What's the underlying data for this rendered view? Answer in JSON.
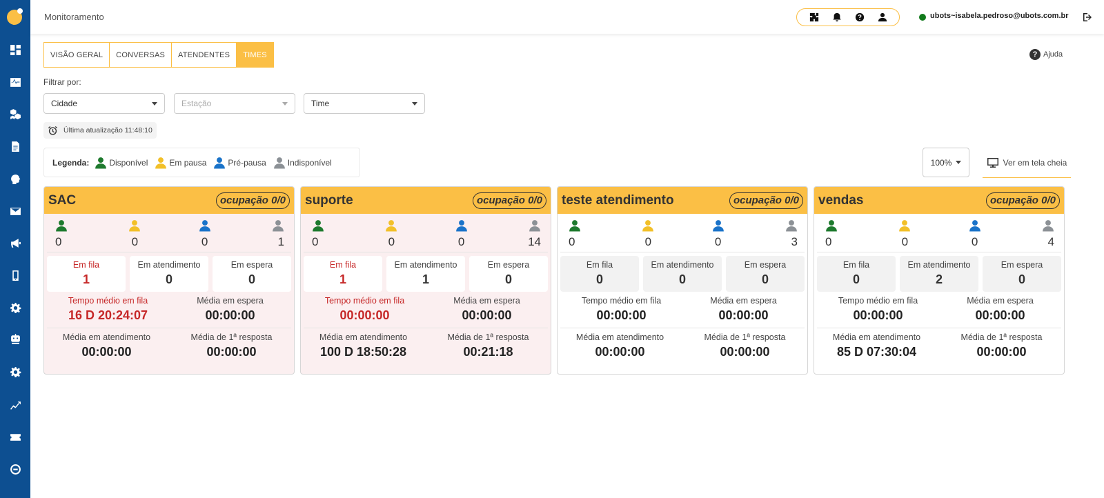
{
  "header": {
    "title": "Monitoramento",
    "user_email": "ubots~isabela.pedroso@ubots.com.br",
    "status_color": "#117a1b"
  },
  "tabs": [
    {
      "label": "VISÃO GERAL",
      "active": false
    },
    {
      "label": "CONVERSAS",
      "active": false
    },
    {
      "label": "ATENDENTES",
      "active": false
    },
    {
      "label": "TIMES",
      "active": true
    }
  ],
  "help_label": "Ajuda",
  "filters": {
    "label": "Filtrar por:",
    "city": "Cidade",
    "station": "Estação",
    "team": "Time"
  },
  "last_update": "Última atualização 11:48:10",
  "legend": {
    "title": "Legenda:",
    "items": [
      {
        "label": "Disponível",
        "color": "#1e7a2e"
      },
      {
        "label": "Em pausa",
        "color": "#f2c029"
      },
      {
        "label": "Pré-pausa",
        "color": "#1a73c9"
      },
      {
        "label": "Indisponível",
        "color": "#8c9196"
      }
    ]
  },
  "zoom": "100%",
  "fullscreen_label": "Ver em tela cheia",
  "teams": [
    {
      "name": "SAC",
      "occupancy": "ocupação 0/0",
      "agents": [
        "0",
        "0",
        "0",
        "1"
      ],
      "queue": {
        "label": "Em fila",
        "value": "1"
      },
      "in_service": {
        "label": "Em atendimento",
        "value": "0"
      },
      "waiting": {
        "label": "Em espera",
        "value": "0"
      },
      "avg_queue": {
        "label": "Tempo médio em fila",
        "value": "16 D 20:24:07"
      },
      "avg_wait": {
        "label": "Média em espera",
        "value": "00:00:00"
      },
      "avg_service": {
        "label": "Média em atendimento",
        "value": "00:00:00"
      },
      "avg_first": {
        "label": "Média de 1ª resposta",
        "value": "00:00:00"
      }
    },
    {
      "name": "suporte",
      "occupancy": "ocupação 0/0",
      "agents": [
        "0",
        "0",
        "0",
        "14"
      ],
      "queue": {
        "label": "Em fila",
        "value": "1"
      },
      "in_service": {
        "label": "Em atendimento",
        "value": "1"
      },
      "waiting": {
        "label": "Em espera",
        "value": "0"
      },
      "avg_queue": {
        "label": "Tempo médio em fila",
        "value": "00:00:00"
      },
      "avg_wait": {
        "label": "Média em espera",
        "value": "00:00:00"
      },
      "avg_service": {
        "label": "Média em atendimento",
        "value": "100 D 18:50:28"
      },
      "avg_first": {
        "label": "Média de 1ª resposta",
        "value": "00:21:18"
      }
    },
    {
      "name": "teste atendimento",
      "occupancy": "ocupação 0/0",
      "agents": [
        "0",
        "0",
        "0",
        "3"
      ],
      "queue": {
        "label": "Em fila",
        "value": "0"
      },
      "in_service": {
        "label": "Em atendimento",
        "value": "0"
      },
      "waiting": {
        "label": "Em espera",
        "value": "0"
      },
      "avg_queue": {
        "label": "Tempo médio em fila",
        "value": "00:00:00"
      },
      "avg_wait": {
        "label": "Média em espera",
        "value": "00:00:00"
      },
      "avg_service": {
        "label": "Média em atendimento",
        "value": "00:00:00"
      },
      "avg_first": {
        "label": "Média de 1ª resposta",
        "value": "00:00:00"
      }
    },
    {
      "name": "vendas",
      "occupancy": "ocupação 0/0",
      "agents": [
        "0",
        "0",
        "0",
        "4"
      ],
      "queue": {
        "label": "Em fila",
        "value": "0"
      },
      "in_service": {
        "label": "Em atendimento",
        "value": "2"
      },
      "waiting": {
        "label": "Em espera",
        "value": "0"
      },
      "avg_queue": {
        "label": "Tempo médio em fila",
        "value": "00:00:00"
      },
      "avg_wait": {
        "label": "Média em espera",
        "value": "00:00:00"
      },
      "avg_service": {
        "label": "Média em atendimento",
        "value": "85 D 07:30:04"
      },
      "avg_first": {
        "label": "Média de 1ª resposta",
        "value": "00:00:00"
      }
    }
  ]
}
